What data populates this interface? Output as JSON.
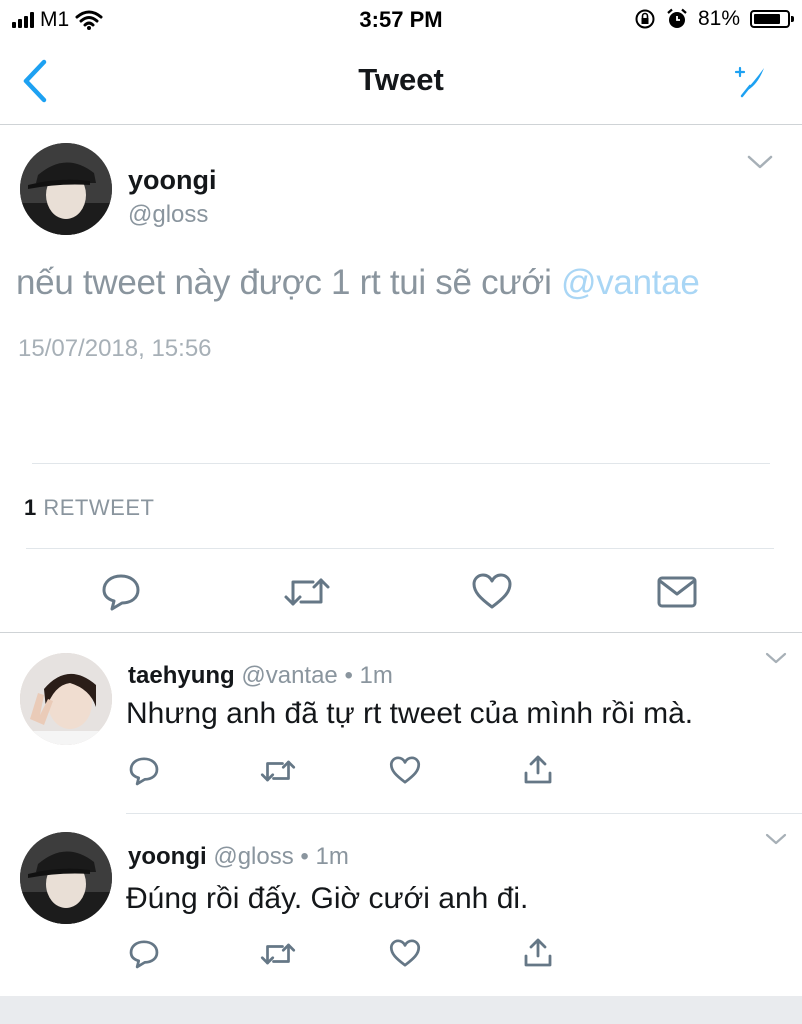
{
  "status_bar": {
    "carrier": "M1",
    "time": "3:57 PM",
    "battery_percent": "81%",
    "battery_level": 0.81
  },
  "nav": {
    "title": "Tweet"
  },
  "main_tweet": {
    "name": "yoongi",
    "handle": "@gloss",
    "text": "nếu tweet này được 1 rt tui sẽ cưới",
    "mention": "@vantae",
    "timestamp": "15/07/2018, 15:56",
    "retweet_count": "1",
    "retweet_label": "RETWEET"
  },
  "replies": [
    {
      "name": "taehyung",
      "handle": "@vantae",
      "time": "1m",
      "separator": "•",
      "text": "Nhưng anh đã tự rt tweet của mình rồi mà."
    },
    {
      "name": "yoongi",
      "handle": "@gloss",
      "time": "1m",
      "separator": "•",
      "text": "Đúng rồi đấy. Giờ cưới anh đi."
    }
  ],
  "colors": {
    "accent": "#1da1f2",
    "mention": "#a9d6f5",
    "secondary_text": "#8a959e",
    "icon": "#657786"
  }
}
